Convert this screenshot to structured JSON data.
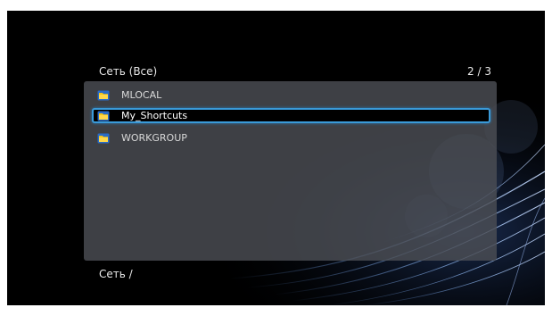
{
  "header": {
    "title": "Сеть (Все)",
    "page_indicator": "2 / 3"
  },
  "list": {
    "items": [
      {
        "label": "MLOCAL",
        "icon": "network-folder-icon",
        "selected": false
      },
      {
        "label": "My_Shortcuts",
        "icon": "network-folder-icon",
        "selected": true
      },
      {
        "label": "WORKGROUP",
        "icon": "network-folder-icon",
        "selected": false
      }
    ]
  },
  "footer": {
    "path": "Сеть /"
  },
  "colors": {
    "selection_border": "#3a9ad8",
    "panel": "#4c4e54",
    "background": "#000000",
    "folder": "#f5c518"
  }
}
